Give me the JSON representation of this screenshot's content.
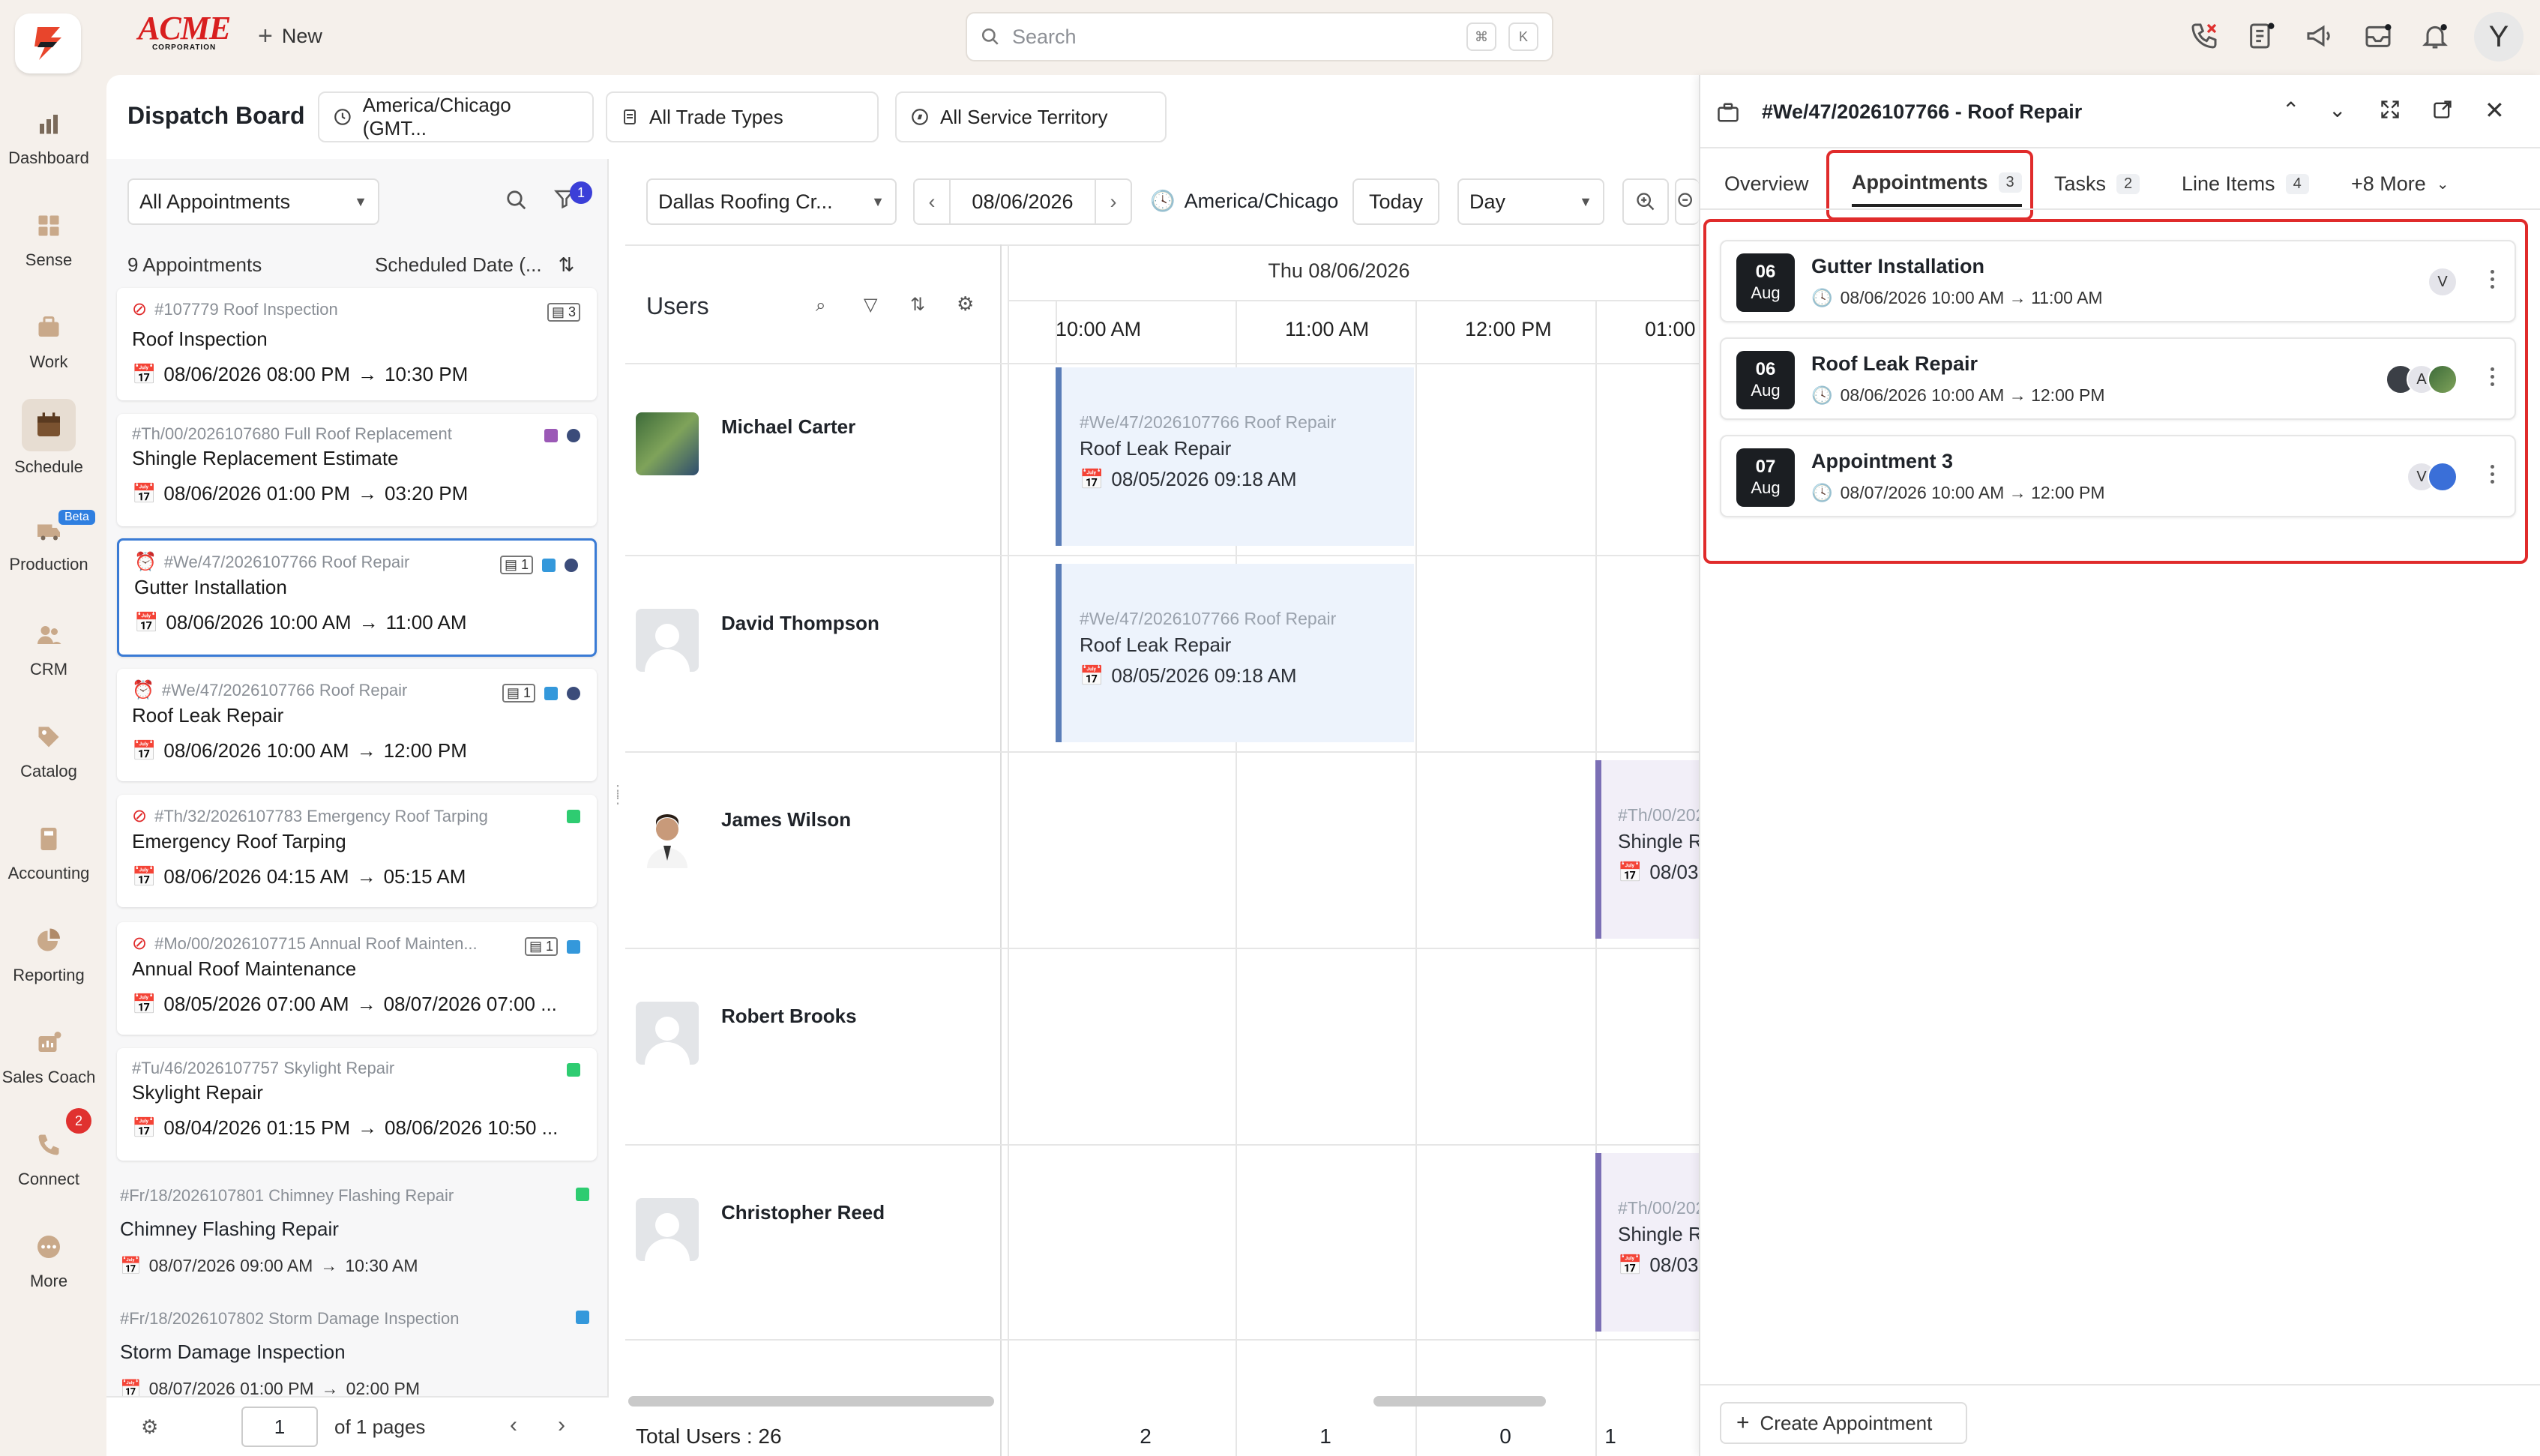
{
  "topbar": {
    "brand_line1": "ACME",
    "brand_line2": "CORPORATION",
    "new_label": "New",
    "search_placeholder": "Search",
    "kbd1": "⌘",
    "kbd2": "K",
    "user_initial": "Y"
  },
  "nav": [
    {
      "label": "Dashboard",
      "icon": "dashboard-icon"
    },
    {
      "label": "Sense",
      "icon": "sense-icon"
    },
    {
      "label": "Work",
      "icon": "work-icon"
    },
    {
      "label": "Schedule",
      "icon": "schedule-icon"
    },
    {
      "label": "Production",
      "icon": "production-icon",
      "badge": "Beta"
    },
    {
      "label": "CRM",
      "icon": "crm-icon"
    },
    {
      "label": "Catalog",
      "icon": "catalog-icon"
    },
    {
      "label": "Accounting",
      "icon": "accounting-icon"
    },
    {
      "label": "Reporting",
      "icon": "reporting-icon"
    },
    {
      "label": "Sales Coach",
      "icon": "sales-coach-icon"
    },
    {
      "label": "Connect",
      "icon": "connect-icon",
      "badge": "2"
    },
    {
      "label": "More",
      "icon": "more-icon"
    }
  ],
  "board": {
    "title": "Dispatch Board",
    "timezone": "America/Chicago (GMT...",
    "trade": "All Trade Types",
    "territory": "All Service Territory"
  },
  "list": {
    "filter": "All Appointments",
    "filter_badge": "1",
    "count": "9 Appointments",
    "sort": "Scheduled Date (...",
    "cards": [
      {
        "ref": "#107779 Roof Inspection",
        "name": "Roof Inspection",
        "start": "08/06/2026 08:00 PM",
        "end": "10:30 PM",
        "doc": "3"
      },
      {
        "ref": "#Th/00/2026107680 Full Roof Replacement",
        "name": "Shingle Replacement Estimate",
        "start": "08/06/2026 01:00 PM",
        "end": "03:20 PM"
      },
      {
        "ref": "#We/47/2026107766 Roof Repair",
        "name": "Gutter Installation",
        "start": "08/06/2026 10:00 AM",
        "end": "11:00 AM",
        "doc": "1"
      },
      {
        "ref": "#We/47/2026107766 Roof Repair",
        "name": "Roof Leak Repair",
        "start": "08/06/2026 10:00 AM",
        "end": "12:00 PM",
        "doc": "1"
      },
      {
        "ref": "#Th/32/2026107783 Emergency Roof Tarping",
        "name": "Emergency Roof Tarping",
        "start": "08/06/2026 04:15 AM",
        "end": "05:15 AM"
      },
      {
        "ref": "#Mo/00/2026107715 Annual Roof Mainten...",
        "name": "Annual Roof Maintenance",
        "start": "08/05/2026 07:00 AM",
        "end": "08/07/2026 07:00 ...",
        "doc": "1"
      },
      {
        "ref": "#Tu/46/2026107757 Skylight Repair",
        "name": "Skylight Repair",
        "start": "08/04/2026 01:15 PM",
        "end": "08/06/2026 10:50 ..."
      },
      {
        "ref": "#Fr/18/2026107801 Chimney Flashing Repair",
        "name": "Chimney Flashing Repair",
        "start": "08/07/2026 09:00 AM",
        "end": "10:30 AM"
      },
      {
        "ref": "#Fr/18/2026107802 Storm Damage Inspection",
        "name": "Storm Damage Inspection",
        "start": "08/07/2026 01:00 PM",
        "end": "02:00 PM"
      }
    ],
    "page": "1",
    "pages": "of 1 pages"
  },
  "sched": {
    "crew": "Dallas Roofing Cr...",
    "date": "08/06/2026",
    "tz": "America/Chicago",
    "today": "Today",
    "view": "Day",
    "users_title": "Users",
    "day_header": "Thu 08/06/2026",
    "hours": [
      "10:00 AM",
      "11:00 AM",
      "12:00 PM",
      "01:00"
    ],
    "users": [
      "Michael Carter",
      "David Thompson",
      "James Wilson",
      "Robert Brooks",
      "Christopher Reed"
    ],
    "total": "Total Users : 26",
    "totals": [
      "2",
      "1",
      "0",
      "1"
    ],
    "ev1": {
      "ref": "#We/47/2026107766 Roof Repair",
      "title": "Roof Leak Repair",
      "date": "08/05/2026 09:18 AM"
    },
    "ev2": {
      "ref": "#We/47/2026107766 Roof Repair",
      "title": "Roof Leak Repair",
      "date": "08/05/2026 09:18 AM"
    },
    "ev3": {
      "ref": "#Th/00/2026",
      "title": "Shingle R",
      "date": "08/03"
    },
    "ev4": {
      "ref": "#Th/00/2026",
      "title": "Shingle R",
      "date": "08/03"
    }
  },
  "detail": {
    "title": "#We/47/2026107766 - Roof Repair",
    "tabs": [
      {
        "label": "Overview"
      },
      {
        "label": "Appointments",
        "count": "3"
      },
      {
        "label": "Tasks",
        "count": "2"
      },
      {
        "label": "Line Items",
        "count": "4"
      },
      {
        "label": "+8 More"
      }
    ],
    "appointments": [
      {
        "day": "06",
        "mon": "Aug",
        "title": "Gutter Installation",
        "time": "08/06/2026 10:00 AM → 11:00 AM"
      },
      {
        "day": "06",
        "mon": "Aug",
        "title": "Roof Leak Repair",
        "time": "08/06/2026 10:00 AM → 12:00 PM"
      },
      {
        "day": "07",
        "mon": "Aug",
        "title": "Appointment 3",
        "time": "08/07/2026 10:00 AM → 12:00 PM"
      }
    ],
    "avatar_v": "V",
    "avatar_a": "A",
    "create": "Create Appointment"
  },
  "colors": {
    "accent": "#3a7bd5",
    "red": "#e02b2b",
    "purple": "#9b59b6",
    "green": "#2ecc71",
    "blue": "#3498db",
    "navy": "#3b4c7a"
  }
}
